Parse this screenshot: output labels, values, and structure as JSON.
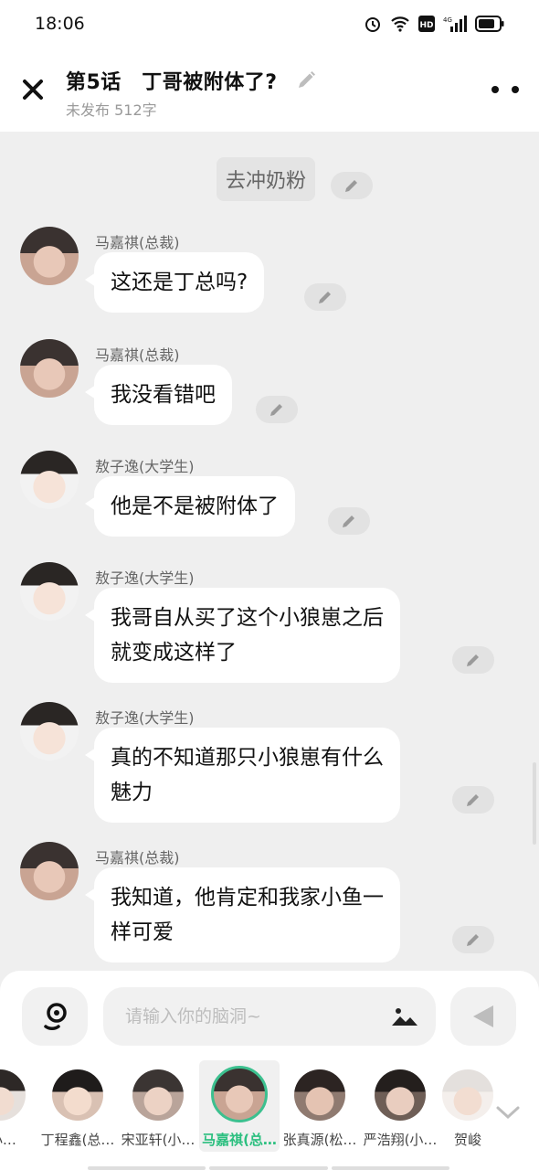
{
  "status_bar": {
    "time": "18:06"
  },
  "header": {
    "title": "第5话　丁哥被附体了?",
    "subtitle": "未发布 512字"
  },
  "chat": {
    "narration": "去冲奶粉",
    "messages": [
      {
        "sender": "马嘉祺(总裁)",
        "text": "这还是丁总吗?"
      },
      {
        "sender": "马嘉祺(总裁)",
        "text": "我没看错吧"
      },
      {
        "sender": "敖子逸(大学生)",
        "text": "他是不是被附体了"
      },
      {
        "sender": "敖子逸(大学生)",
        "line1": "我哥自从买了这个小狼崽之后",
        "line2": "就变成这样了"
      },
      {
        "sender": "敖子逸(大学生)",
        "line1": "真的不知道那只小狼崽有什么",
        "line2": "魅力"
      },
      {
        "sender": "马嘉祺(总裁)",
        "line1": "我知道，他肯定和我家小鱼一",
        "line2": "样可爱"
      }
    ]
  },
  "input": {
    "placeholder": "请输入你的脑洞~"
  },
  "characters": [
    {
      "name": "(小…"
    },
    {
      "name": "丁程鑫(总…"
    },
    {
      "name": "宋亚轩(小…"
    },
    {
      "name": "马嘉祺(总…",
      "selected": true
    },
    {
      "name": "张真源(松…"
    },
    {
      "name": "严浩翔(小…"
    },
    {
      "name": "贺峻"
    }
  ],
  "colors": {
    "accent": "#2bbf7f",
    "background": "#efefef"
  },
  "icons": [
    "close-icon",
    "pencil-icon",
    "more-icon",
    "voice-icon",
    "image-icon",
    "send-icon",
    "chevron-down-icon"
  ]
}
